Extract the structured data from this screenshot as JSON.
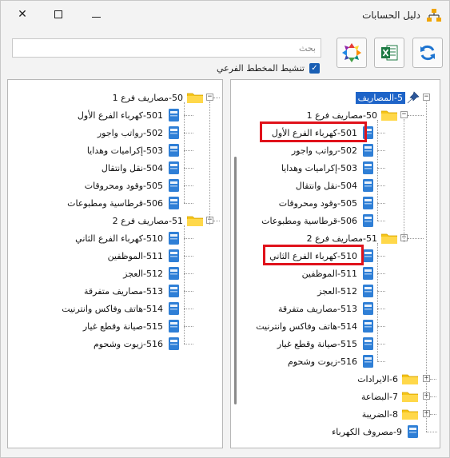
{
  "window": {
    "title": "دليل الحسابات"
  },
  "toolbar": {
    "search_placeholder": "بحث",
    "checkbox_label": "تنشيط المخطط الفرعي",
    "checkbox_checked": true,
    "refresh_icon": "refresh-icon",
    "excel_icon": "excel-icon",
    "arrows_icon": "expand-arrows-icon"
  },
  "left_tree": {
    "groups": [
      {
        "label": "50-مصاريف فرع 1",
        "items": [
          "501-كهرباء الفرع الأول",
          "502-رواتب واجور",
          "503-إكراميات وهدايا",
          "504-نقل وانتقال",
          "505-وقود ومحروقات",
          "506-قرطاسية ومطبوعات"
        ]
      },
      {
        "label": "51-مصاريف فرع 2",
        "items": [
          "510-كهرباء الفرع الثاني",
          "511-الموظفين",
          "512-العجز",
          "513-مصاريف متفرقة",
          "514-هاتف وفاكس وانترنيت",
          "515-صيانة وقطع غيار",
          "516-زيوت وشحوم"
        ]
      }
    ]
  },
  "right_tree": {
    "root_label": "5-المصاريف",
    "groups": [
      {
        "label": "50-مصاريف فرع 1",
        "items": [
          "501-كهرباء الفرع الأول",
          "502-رواتب واجور",
          "503-إكراميات وهدايا",
          "504-نقل وانتقال",
          "505-وقود ومحروقات",
          "506-قرطاسية ومطبوعات"
        ]
      },
      {
        "label": "51-مصاريف فرع 2",
        "items": [
          "510-كهرباء الفرع الثاني",
          "511-الموظفين",
          "512-العجز",
          "513-مصاريف متفرقة",
          "514-هاتف وفاكس وانترنيت",
          "515-صيانة وقطع غيار",
          "516-زيوت وشحوم"
        ]
      }
    ],
    "top_level": [
      "6-الايرادات",
      "7-البضاعة",
      "8-الضريبة",
      "9-مصروف الكهرباء"
    ]
  },
  "colors": {
    "selection": "#1e64c8",
    "highlight": "#e0121b",
    "folder": "#f5c518",
    "doc": "#2f7fd6"
  }
}
